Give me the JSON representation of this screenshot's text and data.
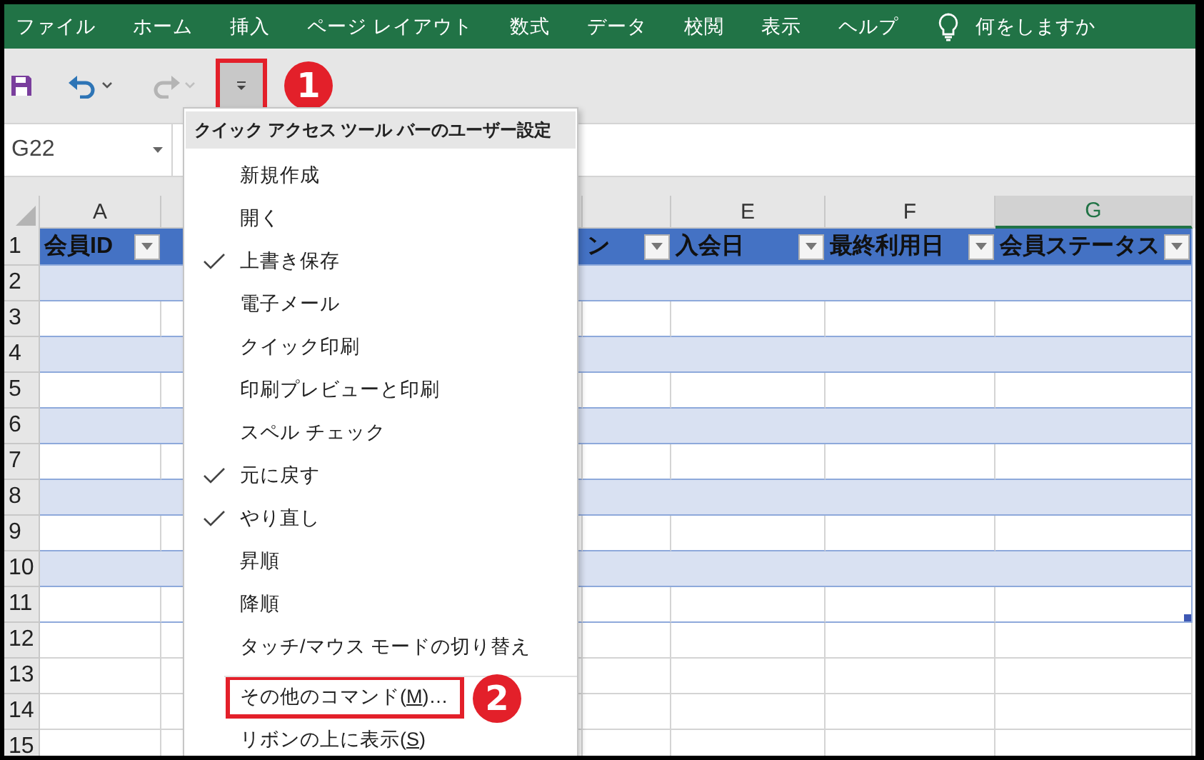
{
  "ribbon_tabs": [
    {
      "label": "ファイル"
    },
    {
      "label": "ホーム"
    },
    {
      "label": "挿入"
    },
    {
      "label": "ページ レイアウト"
    },
    {
      "label": "数式"
    },
    {
      "label": "データ"
    },
    {
      "label": "校閲"
    },
    {
      "label": "表示"
    },
    {
      "label": "ヘルプ"
    }
  ],
  "tell_me": {
    "placeholder": "何をしますか"
  },
  "quick_access": [
    {
      "kind": "save",
      "disabled": false
    },
    {
      "kind": "undo",
      "disabled": false
    },
    {
      "kind": "redo",
      "disabled": true
    }
  ],
  "customize_button": {
    "callout": "1"
  },
  "name_box": {
    "value": "G22"
  },
  "columns": [
    {
      "letter": "A",
      "selected": false,
      "header": "会員ID"
    },
    {},
    {},
    {
      "header": "ン"
    },
    {
      "letter": "E",
      "selected": false,
      "header": "入会日"
    },
    {
      "letter": "F",
      "selected": false,
      "header": "最終利用日"
    },
    {
      "letter": "G",
      "selected": true,
      "header": "会員ステータス"
    }
  ],
  "rows": [
    {
      "number": "1",
      "kind": "header"
    },
    {
      "number": "2",
      "kind": "band"
    },
    {
      "number": "3",
      "kind": "plain"
    },
    {
      "number": "4",
      "kind": "band"
    },
    {
      "number": "5",
      "kind": "plain"
    },
    {
      "number": "6",
      "kind": "band"
    },
    {
      "number": "7",
      "kind": "plain"
    },
    {
      "number": "8",
      "kind": "band"
    },
    {
      "number": "9",
      "kind": "plain"
    },
    {
      "number": "10",
      "kind": "band"
    },
    {
      "number": "11",
      "kind": "last"
    },
    {
      "number": "12",
      "kind": "sheet"
    },
    {
      "number": "13",
      "kind": "sheet"
    },
    {
      "number": "14",
      "kind": "sheet"
    },
    {
      "number": "15",
      "kind": "sheet"
    }
  ],
  "menu": {
    "title": "クイック アクセス ツール バーのユーザー設定",
    "items": [
      {
        "label": "新規作成",
        "checked": false
      },
      {
        "label": "開く",
        "checked": false
      },
      {
        "label": "上書き保存",
        "checked": true
      },
      {
        "label": "電子メール",
        "checked": false
      },
      {
        "label": "クイック印刷",
        "checked": false
      },
      {
        "label": "印刷プレビューと印刷",
        "checked": false
      },
      {
        "label": "スペル チェック",
        "checked": false
      },
      {
        "label": "元に戻す",
        "checked": true
      },
      {
        "label": "やり直し",
        "checked": true
      },
      {
        "label": "昇順",
        "checked": false
      },
      {
        "label": "降順",
        "checked": false
      },
      {
        "label": "タッチ/マウス モードの切り替え",
        "checked": false
      },
      {
        "label": "その他のコマンド(",
        "accel": "M",
        "label_end": ")…",
        "checked": false,
        "separator_before": true,
        "callout": "2"
      },
      {
        "label": "リボンの上に表示(",
        "accel": "S",
        "label_end": ")",
        "checked": false
      }
    ]
  }
}
